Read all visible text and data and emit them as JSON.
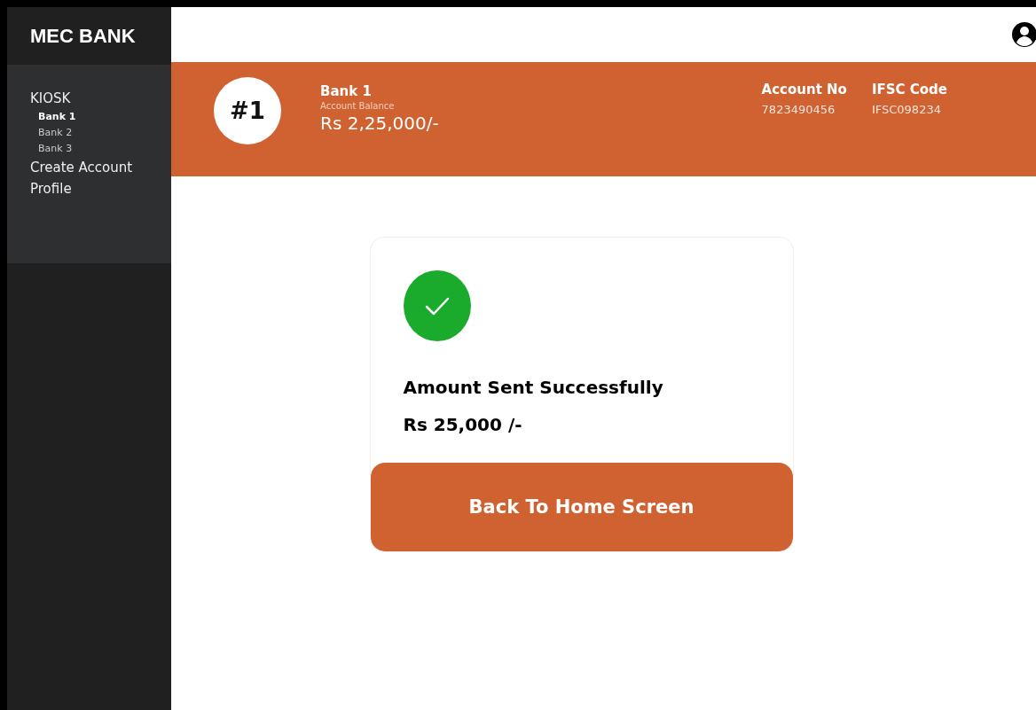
{
  "brand": "MEC BANK",
  "sidebar": {
    "items": [
      {
        "label": "KIOSK",
        "selected": false,
        "children": [
          {
            "label": "Bank 1",
            "selected": true
          },
          {
            "label": "Bank 2",
            "selected": false
          },
          {
            "label": "Bank 3",
            "selected": false
          }
        ]
      },
      {
        "label": "Create Account",
        "selected": false
      },
      {
        "label": "Profile",
        "selected": false
      }
    ]
  },
  "account": {
    "badge": "#1",
    "name": "Bank 1",
    "balance_label": "Account Balance",
    "balance": "Rs 2,25,000/-",
    "fields": [
      {
        "label": "Account No",
        "value": "7823490456"
      },
      {
        "label": "IFSC Code",
        "value": "IFSC098234"
      }
    ]
  },
  "result": {
    "message": "Amount Sent Successfully",
    "amount": "Rs 25,000 /-",
    "button": "Back To Home Screen"
  }
}
